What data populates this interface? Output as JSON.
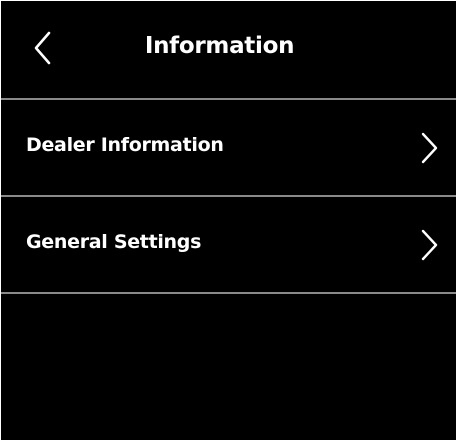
{
  "header": {
    "title": "Information",
    "back_icon": "chevron-left-icon"
  },
  "menu": {
    "items": [
      {
        "label": "Dealer Information",
        "icon": "chevron-right-icon"
      },
      {
        "label": "General Settings",
        "icon": "chevron-right-icon"
      }
    ]
  },
  "colors": {
    "background": "#000000",
    "text": "#ffffff",
    "divider": "#8a8a8a"
  }
}
